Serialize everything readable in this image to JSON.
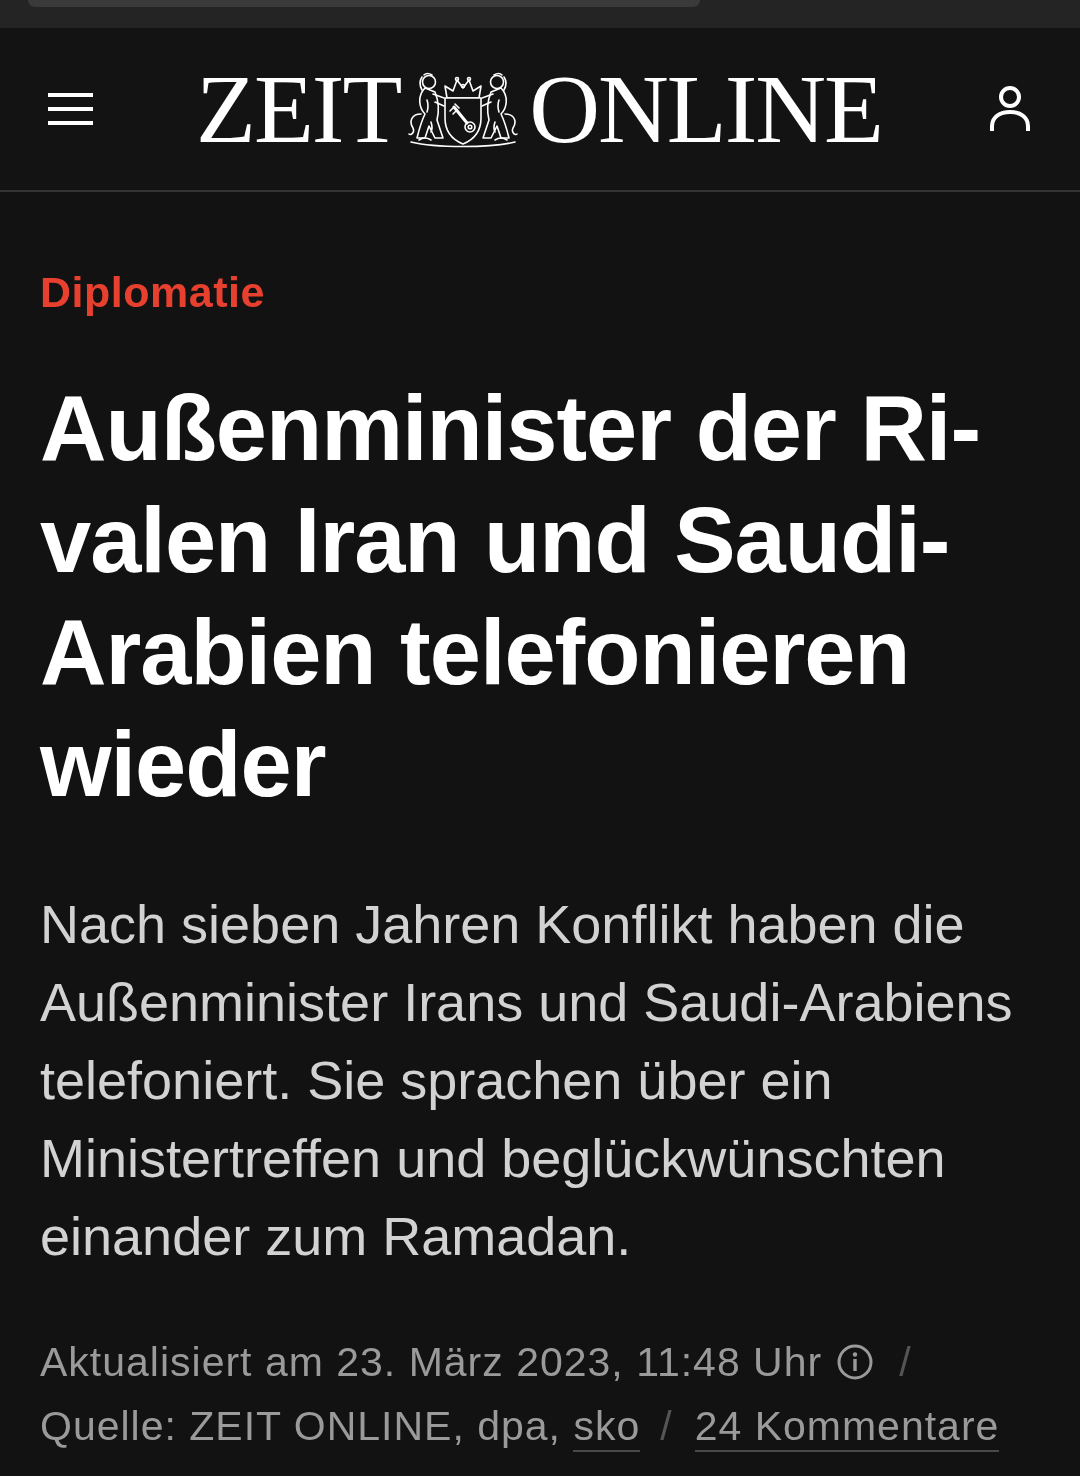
{
  "header": {
    "logo": {
      "left": "ZEIT",
      "right": "ONLINE"
    }
  },
  "article": {
    "kicker": "Diplomatie",
    "headline_lines": [
      "Außenminister der Ri-",
      "valen Iran und Saudi-",
      "Arabien telefonieren",
      "wieder"
    ],
    "lead": "Nach sieben Jahren Konflikt haben die Außenminister Irans und Saudi-Arabiens telefoniert. Sie sprachen über ein Ministertreffen und beglückwünschten einander zum Ramadan.",
    "meta": {
      "updated": "Aktualisiert am 23. März 2023, 11:48 Uhr",
      "separator_1": "/",
      "source": "Quelle: ZEIT ONLINE, dpa,",
      "author": "sko",
      "separator_2": "/",
      "comments": "24 Kommentare"
    }
  }
}
